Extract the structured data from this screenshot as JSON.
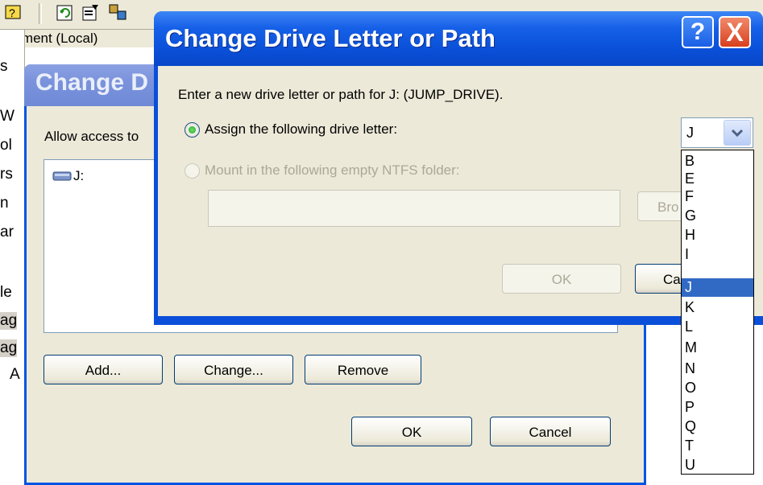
{
  "background": {
    "toolbar_icons": [
      "help-topic-icon",
      "refresh-icon",
      "properties-icon",
      "snap-in-icon"
    ],
    "address_text": "gement (Local)",
    "tree_fragments": [
      "s",
      "W",
      "ol",
      "rs",
      "n",
      "ar",
      "le",
      "ag",
      "ag",
      "A"
    ]
  },
  "back_dialog": {
    "title": "Change D",
    "allow_label": "Allow access to",
    "list_items": [
      "J:"
    ],
    "buttons": {
      "add": "Add...",
      "change": "Change...",
      "remove": "Remove",
      "ok": "OK",
      "cancel": "Cancel"
    }
  },
  "front_dialog": {
    "title": "Change Drive Letter or Path",
    "help_glyph": "?",
    "close_glyph": "X",
    "instruction": "Enter a new drive letter or path for J: (JUMP_DRIVE).",
    "option_assign": "Assign the following drive letter:",
    "option_mount": "Mount in the following empty NTFS folder:",
    "path_value": "",
    "browse_label": "Bro",
    "ok_label": "OK",
    "cancel_label": "Ca",
    "selected_letter": "J",
    "letters": [
      "B",
      "E",
      "F",
      "G",
      "H",
      "I",
      "J",
      "K",
      "L",
      "M",
      "N",
      "O",
      "P",
      "Q",
      "T",
      "U"
    ],
    "highlighted_letter": "J"
  },
  "colors": {
    "title_active": "#0a50d8",
    "title_inactive": "#7b93dc",
    "face": "#ece9d8",
    "selection": "#316ac5"
  }
}
